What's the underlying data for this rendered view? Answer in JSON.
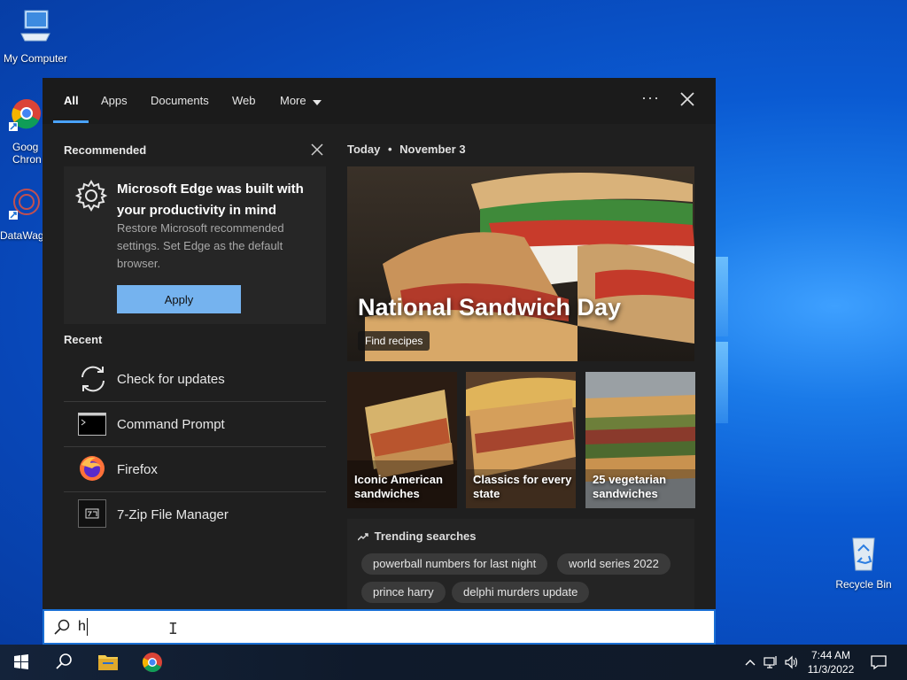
{
  "desktop": {
    "icons": [
      {
        "label": "My Computer"
      },
      {
        "label": "Goog\nChron"
      },
      {
        "label": "DataWag"
      },
      {
        "label": "Recycle Bin"
      }
    ]
  },
  "search_panel": {
    "tabs": [
      "All",
      "Apps",
      "Documents",
      "Web",
      "More"
    ],
    "active_tab": "All",
    "recommended": {
      "section_title": "Recommended",
      "card_title": "Microsoft Edge was built with your productivity in mind",
      "card_description": "Restore Microsoft recommended settings. Set Edge as the default browser.",
      "apply_label": "Apply"
    },
    "recent": {
      "section_title": "Recent",
      "items": [
        {
          "label": "Check for updates",
          "icon": "refresh-icon"
        },
        {
          "label": "Command Prompt",
          "icon": "cmd-icon"
        },
        {
          "label": "Firefox",
          "icon": "firefox-icon"
        },
        {
          "label": "7-Zip File Manager",
          "icon": "7zip-icon"
        }
      ]
    },
    "today": {
      "label": "Today",
      "date": "November 3",
      "hero_title": "National Sandwich Day",
      "hero_button": "Find recipes",
      "tiles": [
        {
          "label": "Iconic American sandwiches"
        },
        {
          "label": "Classics for every state"
        },
        {
          "label": "25 vegetarian sandwiches"
        }
      ]
    },
    "trending": {
      "title": "Trending searches",
      "chips": [
        "powerball numbers for last night",
        "world series 2022",
        "prince harry",
        "delphi murders update"
      ]
    }
  },
  "search_box": {
    "value": "h"
  },
  "taskbar": {
    "time": "7:44 AM",
    "date": "11/3/2022"
  },
  "colors": {
    "accent": "#4aa3ff",
    "apply_button": "#75b3ef",
    "panel_bg": "#1f1f1f"
  }
}
